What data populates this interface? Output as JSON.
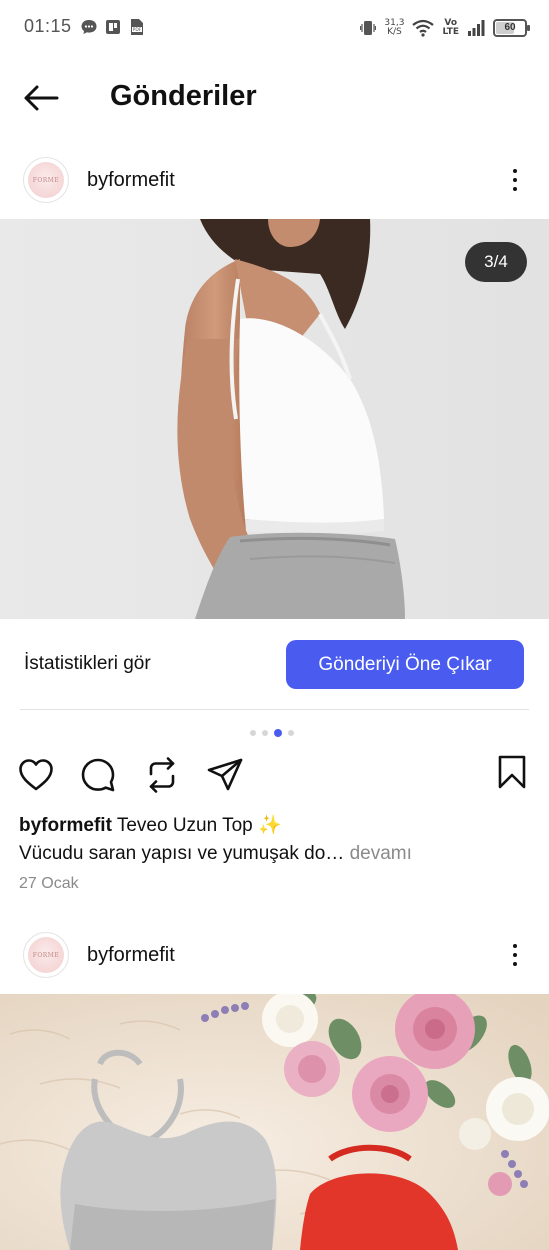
{
  "status_bar": {
    "time": "01:15",
    "net_speed_value": "31,3",
    "net_speed_unit": "K/S",
    "volte_top": "Vo",
    "volte_bottom": "LTE",
    "battery": "60"
  },
  "header": {
    "title": "Gönderiler"
  },
  "posts": [
    {
      "username": "byformefit",
      "avatar_text": "FORME",
      "media_counter": "3/4",
      "media_current": 3,
      "media_total": 4,
      "stats_label": "İstatistikleri gör",
      "boost_label": "Gönderiyi Öne Çıkar",
      "caption_user": "byformefit",
      "caption_text": "Teveo Uzun Top ✨",
      "caption_line2": "Vücudu saran yapısı ve yumuşak do…",
      "caption_more": "devamı",
      "date": "27 Ocak"
    },
    {
      "username": "byformefit",
      "avatar_text": "FORME"
    }
  ],
  "icons": [
    "back-arrow-icon",
    "more-vertical-icon",
    "heart-icon",
    "comment-icon",
    "repost-icon",
    "share-icon",
    "bookmark-icon"
  ],
  "colors": {
    "accent": "#4a5cf0",
    "counter_bg": "#333333",
    "muted_text": "#8a8a8a"
  }
}
